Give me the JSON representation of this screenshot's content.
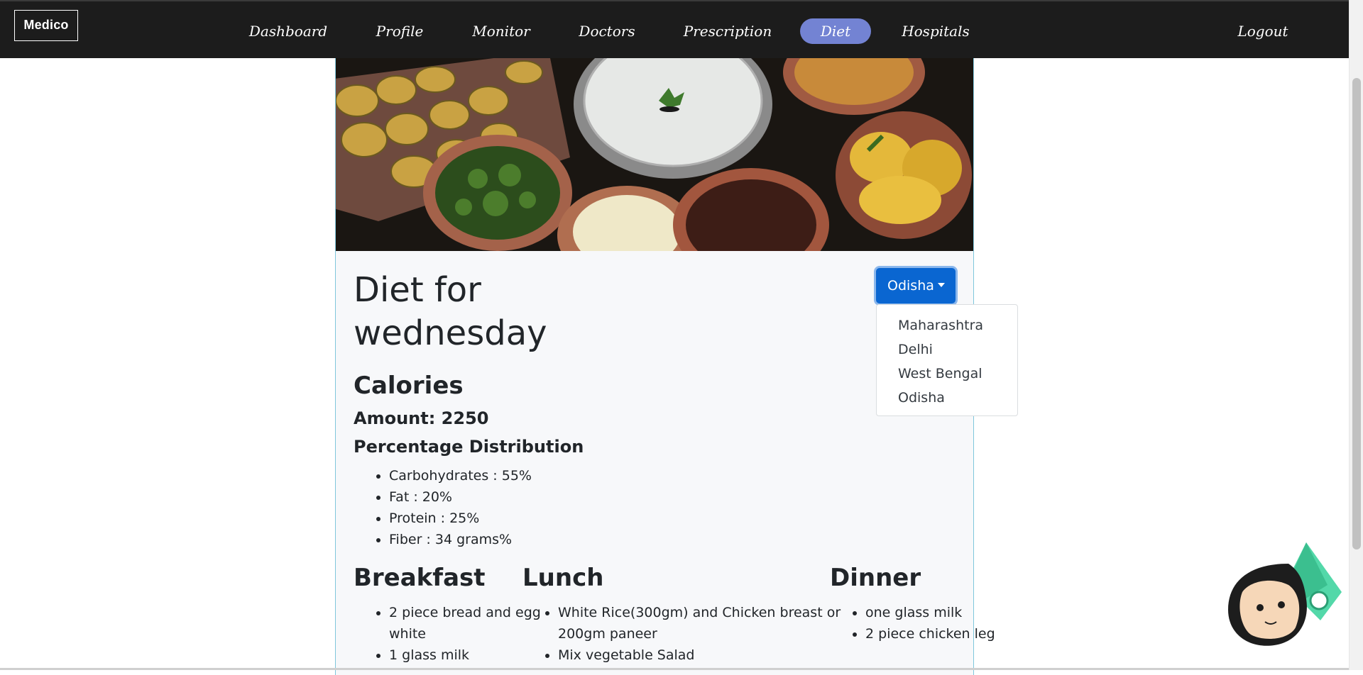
{
  "navbar": {
    "brand": "Medico",
    "links": [
      "Dashboard",
      "Profile",
      "Monitor",
      "Doctors",
      "Prescription",
      "Diet",
      "Hospitals"
    ],
    "active": "Diet",
    "logout": "Logout"
  },
  "diet": {
    "title": "Diet for wednesday",
    "calories_heading": "Calories",
    "amount": "Amount: 2250",
    "distribution_heading": "Percentage Distribution",
    "distribution": [
      "Carbohydrates : 55%",
      "Fat : 20%",
      "Protein : 25%",
      "Fiber : 34 grams%"
    ],
    "breakfast": {
      "heading": "Breakfast",
      "items": [
        "2 piece bread and egg white",
        "1 glass milk"
      ]
    },
    "lunch": {
      "heading": "Lunch",
      "items": [
        "White Rice(300gm) and Chicken breast or 200gm paneer",
        "Mix vegetable Salad"
      ]
    },
    "dinner": {
      "heading": "Dinner",
      "items": [
        "one glass milk",
        "2 piece chicken leg"
      ]
    }
  },
  "state_dropdown": {
    "selected": "Odisha",
    "options": [
      "Maharashtra",
      "Delhi",
      "West Bengal",
      "Odisha"
    ]
  },
  "colors": {
    "navbar_bg": "#1c1c1c",
    "active_pill": "#7383d3",
    "dropdown_button": "#0a66d1",
    "card_bg": "#f7f8fa",
    "card_border": "#7fc7dc"
  },
  "icons": {
    "mascot": "doctor-mascot-icon",
    "caret": "caret-down-icon"
  }
}
